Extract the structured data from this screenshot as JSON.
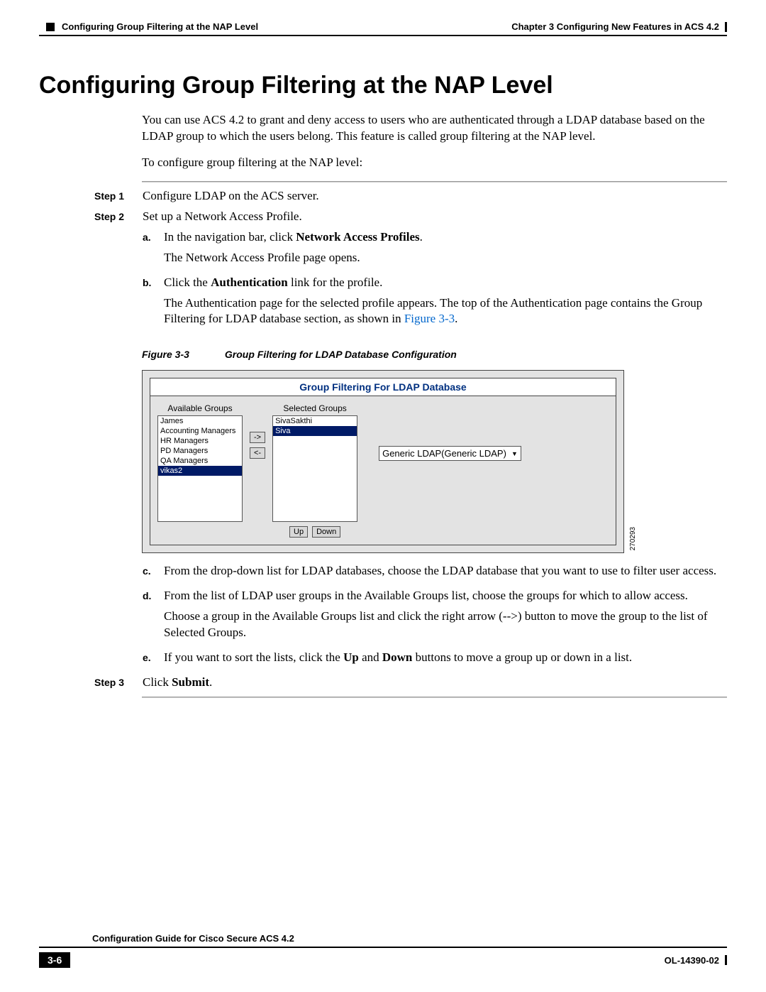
{
  "header": {
    "left_section": "Configuring Group Filtering at the NAP Level",
    "right_chapter": "Chapter 3      Configuring New Features in ACS 4.2"
  },
  "heading": "Configuring Group Filtering at the NAP Level",
  "intro_p1": "You can use ACS 4.2 to grant and deny access to users who are authenticated through a LDAP database based on the LDAP group to which the users belong. This feature is called group filtering at the NAP level.",
  "intro_p2": "To configure group filtering at the NAP level:",
  "steps": {
    "s1": {
      "label": "Step 1",
      "text": "Configure LDAP on the ACS server."
    },
    "s2": {
      "label": "Step 2",
      "text": "Set up a Network Access Profile."
    },
    "s3": {
      "label": "Step 3",
      "pre": "Click ",
      "bold": "Submit",
      "post": "."
    }
  },
  "sub": {
    "a": {
      "label": "a.",
      "l1_pre": "In the navigation bar, click ",
      "l1_bold": "Network Access Profiles",
      "l1_post": ".",
      "l2": "The Network Access Profile page opens."
    },
    "b": {
      "label": "b.",
      "l1_pre": "Click the ",
      "l1_bold": "Authentication",
      "l1_post": " link for the profile.",
      "l2_pre": "The Authentication page for the selected profile appears. The top of the Authentication page contains the Group Filtering for LDAP database section, as shown in ",
      "l2_link": "Figure 3-3",
      "l2_post": "."
    },
    "c": {
      "label": "c.",
      "text": "From the drop-down list for LDAP databases, choose the LDAP database that you want to use to filter user access."
    },
    "d": {
      "label": "d.",
      "l1": "From the list of LDAP user groups in the Available Groups list, choose the groups for which to allow access.",
      "l2": "Choose a group in the Available Groups list and click the right arrow (-->) button to move the group to the list of Selected Groups."
    },
    "e": {
      "label": "e.",
      "pre": "If you want to sort the lists, click the ",
      "b1": "Up",
      "mid": " and ",
      "b2": "Down",
      "post": " buttons to move a group up or down in a list."
    }
  },
  "figure": {
    "num": "Figure 3-3",
    "title": "Group Filtering for LDAP Database Configuration",
    "panel_title": "Group Filtering For LDAP Database",
    "available_label": "Available Groups",
    "selected_label": "Selected Groups",
    "available": [
      "James",
      "Accounting Managers",
      "HR Managers",
      "PD Managers",
      "QA Managers",
      "vikas2"
    ],
    "selected": [
      "SivaSakthi",
      "Siva"
    ],
    "btn_right": "->",
    "btn_left": "<-",
    "btn_up": "Up",
    "btn_down": "Down",
    "ldap_select": "Generic LDAP(Generic LDAP)",
    "image_id": "270293"
  },
  "footer": {
    "guide": "Configuration Guide for Cisco Secure ACS 4.2",
    "page": "3-6",
    "doc": "OL-14390-02"
  }
}
